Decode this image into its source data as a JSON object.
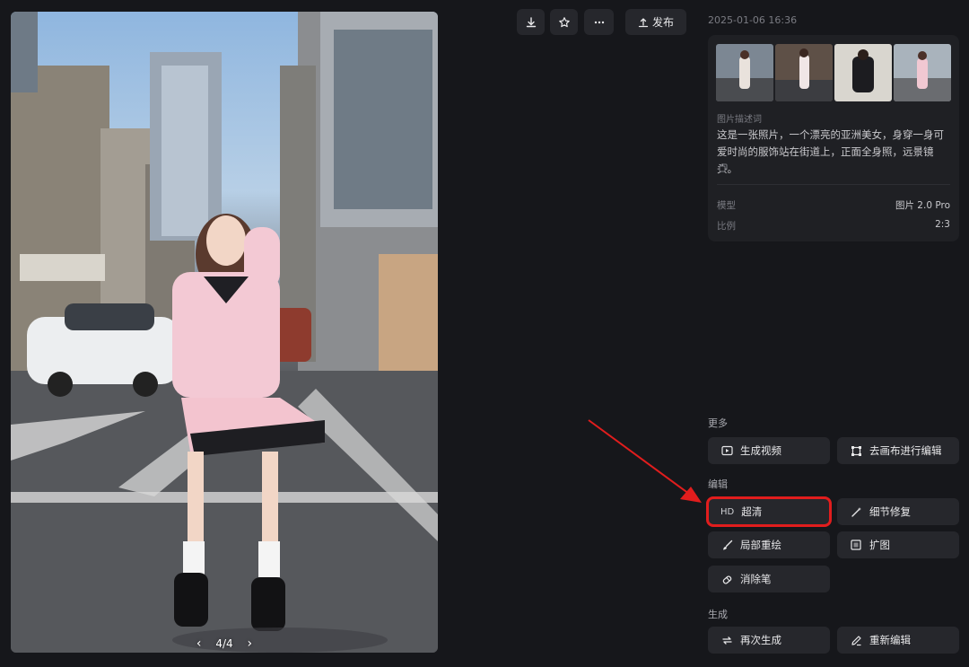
{
  "image_viewer": {
    "pager": "4/4",
    "prev_icon": "chevron-left-icon",
    "next_icon": "chevron-right-icon"
  },
  "toolbar": {
    "download_icon": "download-icon",
    "favorite_icon": "star-icon",
    "more_icon": "more-horizontal-icon",
    "publish_label": "发布"
  },
  "meta": {
    "timestamp": "2025-01-06 16:36",
    "description_label": "图片描述词",
    "description": "这是一张照片，一个漂亮的亚洲美女，身穿一身可爱时尚的服饰站在街道上，正面全身照，远景镜头。",
    "model_label": "模型",
    "model_value": "图片 2.0 Pro",
    "ratio_label": "比例",
    "ratio_value": "2:3"
  },
  "sections": {
    "more": {
      "title": "更多",
      "generate_video": "生成视频",
      "canvas_edit": "去画布进行编辑"
    },
    "edit": {
      "title": "编辑",
      "hd_badge": "HD",
      "upscale": "超清",
      "detail_fix": "细节修复",
      "inpaint": "局部重绘",
      "outpaint": "扩图",
      "eraser": "消除笔"
    },
    "generate": {
      "title": "生成",
      "regenerate": "再次生成",
      "reedit": "重新编辑"
    }
  },
  "colors": {
    "background": "#16171b",
    "panel": "#1f2024",
    "button": "#26272c",
    "highlight": "#e11d1d"
  }
}
